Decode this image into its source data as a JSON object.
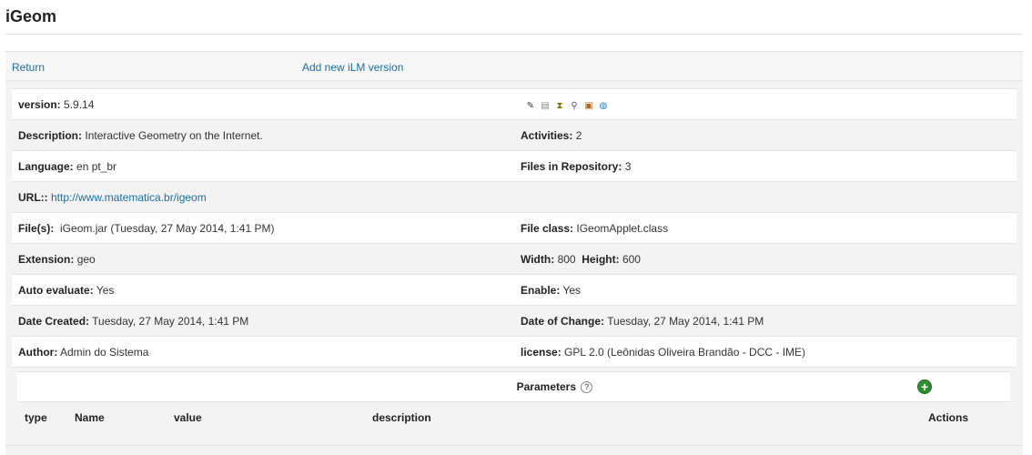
{
  "page": {
    "title": "iGeom"
  },
  "nav": {
    "return_label": "Return",
    "add_version_label": "Add new iLM version"
  },
  "info": {
    "version_label": "version:",
    "version_value": "5.9.14",
    "description_label": "Description:",
    "description_value": "Interactive Geometry on the Internet.",
    "activities_label": "Activities:",
    "activities_value": "2",
    "language_label": "Language:",
    "language_value": "en pt_br",
    "files_repo_label": "Files in Repository:",
    "files_repo_value": "3",
    "url_label": "URL::",
    "url_value": "http://www.matematica.br/igeom",
    "files_label": "File(s):",
    "files_value": "iGeom.jar (Tuesday, 27 May 2014, 1:41 PM)",
    "file_class_label": "File class:",
    "file_class_value": "IGeomApplet.class",
    "extension_label": "Extension:",
    "extension_value": "geo",
    "width_label": "Width:",
    "width_value": "800",
    "height_label": "Height:",
    "height_value": "600",
    "auto_eval_label": "Auto evaluate:",
    "auto_eval_value": "Yes",
    "enable_label": "Enable:",
    "enable_value": "Yes",
    "date_created_label": "Date Created:",
    "date_created_value": "Tuesday, 27 May 2014, 1:41 PM",
    "date_change_label": "Date of Change:",
    "date_change_value": "Tuesday, 27 May 2014, 1:41 PM",
    "author_label": "Author:",
    "author_value": "Admin do Sistema",
    "license_label": "license:",
    "license_value": "GPL 2.0 (Leônidas Oliveira Brandão - DCC - IME)"
  },
  "tools": {
    "icons": [
      "edit-icon",
      "copy-icon",
      "export-icon",
      "preview-icon",
      "package-icon",
      "web-icon"
    ],
    "glyphs": [
      "✎",
      "▤",
      "⧗",
      "⚲",
      "▣",
      "◍"
    ],
    "colors": [
      "#333333",
      "#888888",
      "#8a6d00",
      "#5a4b9c",
      "#b5651d",
      "#2a7fbf"
    ]
  },
  "params": {
    "title": "Parameters",
    "help_glyph": "?",
    "add_glyph": "+",
    "columns": [
      "type",
      "Name",
      "value",
      "description",
      "Actions"
    ]
  }
}
